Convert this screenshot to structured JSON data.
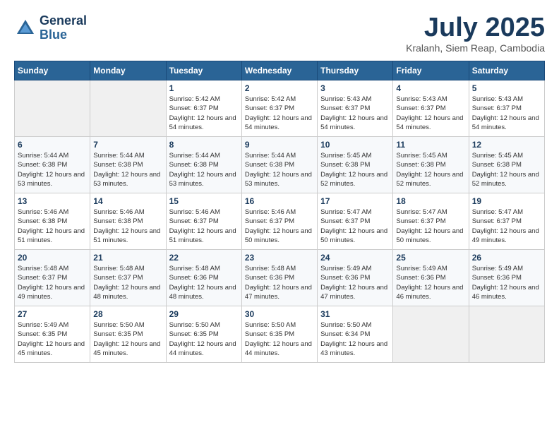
{
  "logo": {
    "line1": "General",
    "line2": "Blue"
  },
  "title": "July 2025",
  "location": "Kralanh, Siem Reap, Cambodia",
  "days_of_week": [
    "Sunday",
    "Monday",
    "Tuesday",
    "Wednesday",
    "Thursday",
    "Friday",
    "Saturday"
  ],
  "weeks": [
    [
      {
        "day": "",
        "info": ""
      },
      {
        "day": "",
        "info": ""
      },
      {
        "day": "1",
        "info": "Sunrise: 5:42 AM\nSunset: 6:37 PM\nDaylight: 12 hours and 54 minutes."
      },
      {
        "day": "2",
        "info": "Sunrise: 5:42 AM\nSunset: 6:37 PM\nDaylight: 12 hours and 54 minutes."
      },
      {
        "day": "3",
        "info": "Sunrise: 5:43 AM\nSunset: 6:37 PM\nDaylight: 12 hours and 54 minutes."
      },
      {
        "day": "4",
        "info": "Sunrise: 5:43 AM\nSunset: 6:37 PM\nDaylight: 12 hours and 54 minutes."
      },
      {
        "day": "5",
        "info": "Sunrise: 5:43 AM\nSunset: 6:37 PM\nDaylight: 12 hours and 54 minutes."
      }
    ],
    [
      {
        "day": "6",
        "info": "Sunrise: 5:44 AM\nSunset: 6:38 PM\nDaylight: 12 hours and 53 minutes."
      },
      {
        "day": "7",
        "info": "Sunrise: 5:44 AM\nSunset: 6:38 PM\nDaylight: 12 hours and 53 minutes."
      },
      {
        "day": "8",
        "info": "Sunrise: 5:44 AM\nSunset: 6:38 PM\nDaylight: 12 hours and 53 minutes."
      },
      {
        "day": "9",
        "info": "Sunrise: 5:44 AM\nSunset: 6:38 PM\nDaylight: 12 hours and 53 minutes."
      },
      {
        "day": "10",
        "info": "Sunrise: 5:45 AM\nSunset: 6:38 PM\nDaylight: 12 hours and 52 minutes."
      },
      {
        "day": "11",
        "info": "Sunrise: 5:45 AM\nSunset: 6:38 PM\nDaylight: 12 hours and 52 minutes."
      },
      {
        "day": "12",
        "info": "Sunrise: 5:45 AM\nSunset: 6:38 PM\nDaylight: 12 hours and 52 minutes."
      }
    ],
    [
      {
        "day": "13",
        "info": "Sunrise: 5:46 AM\nSunset: 6:38 PM\nDaylight: 12 hours and 51 minutes."
      },
      {
        "day": "14",
        "info": "Sunrise: 5:46 AM\nSunset: 6:38 PM\nDaylight: 12 hours and 51 minutes."
      },
      {
        "day": "15",
        "info": "Sunrise: 5:46 AM\nSunset: 6:37 PM\nDaylight: 12 hours and 51 minutes."
      },
      {
        "day": "16",
        "info": "Sunrise: 5:46 AM\nSunset: 6:37 PM\nDaylight: 12 hours and 50 minutes."
      },
      {
        "day": "17",
        "info": "Sunrise: 5:47 AM\nSunset: 6:37 PM\nDaylight: 12 hours and 50 minutes."
      },
      {
        "day": "18",
        "info": "Sunrise: 5:47 AM\nSunset: 6:37 PM\nDaylight: 12 hours and 50 minutes."
      },
      {
        "day": "19",
        "info": "Sunrise: 5:47 AM\nSunset: 6:37 PM\nDaylight: 12 hours and 49 minutes."
      }
    ],
    [
      {
        "day": "20",
        "info": "Sunrise: 5:48 AM\nSunset: 6:37 PM\nDaylight: 12 hours and 49 minutes."
      },
      {
        "day": "21",
        "info": "Sunrise: 5:48 AM\nSunset: 6:37 PM\nDaylight: 12 hours and 48 minutes."
      },
      {
        "day": "22",
        "info": "Sunrise: 5:48 AM\nSunset: 6:36 PM\nDaylight: 12 hours and 48 minutes."
      },
      {
        "day": "23",
        "info": "Sunrise: 5:48 AM\nSunset: 6:36 PM\nDaylight: 12 hours and 47 minutes."
      },
      {
        "day": "24",
        "info": "Sunrise: 5:49 AM\nSunset: 6:36 PM\nDaylight: 12 hours and 47 minutes."
      },
      {
        "day": "25",
        "info": "Sunrise: 5:49 AM\nSunset: 6:36 PM\nDaylight: 12 hours and 46 minutes."
      },
      {
        "day": "26",
        "info": "Sunrise: 5:49 AM\nSunset: 6:36 PM\nDaylight: 12 hours and 46 minutes."
      }
    ],
    [
      {
        "day": "27",
        "info": "Sunrise: 5:49 AM\nSunset: 6:35 PM\nDaylight: 12 hours and 45 minutes."
      },
      {
        "day": "28",
        "info": "Sunrise: 5:50 AM\nSunset: 6:35 PM\nDaylight: 12 hours and 45 minutes."
      },
      {
        "day": "29",
        "info": "Sunrise: 5:50 AM\nSunset: 6:35 PM\nDaylight: 12 hours and 44 minutes."
      },
      {
        "day": "30",
        "info": "Sunrise: 5:50 AM\nSunset: 6:35 PM\nDaylight: 12 hours and 44 minutes."
      },
      {
        "day": "31",
        "info": "Sunrise: 5:50 AM\nSunset: 6:34 PM\nDaylight: 12 hours and 43 minutes."
      },
      {
        "day": "",
        "info": ""
      },
      {
        "day": "",
        "info": ""
      }
    ]
  ]
}
